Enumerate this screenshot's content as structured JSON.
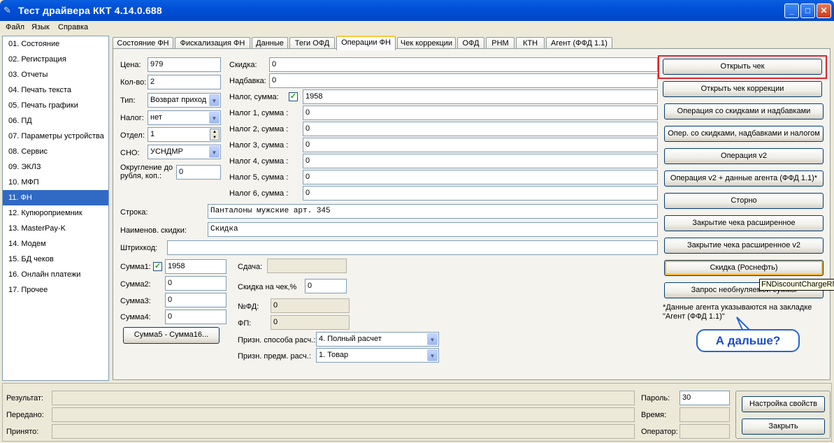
{
  "window": {
    "title": "Тест драйвера ККТ 4.14.0.688",
    "controls": {
      "minimize": "_",
      "maximize": "□",
      "close": "✕"
    },
    "title_color": "#0050d8"
  },
  "menu": [
    "Файл",
    "Язык",
    "Справка"
  ],
  "nav": {
    "items": [
      "01. Состояние",
      "02. Регистрация",
      "03. Отчеты",
      "04. Печать текста",
      "05. Печать графики",
      "06. ПД",
      "07. Параметры устройства",
      "08. Сервис",
      "09. ЭКЛЗ",
      "10. МФП",
      "11. ФН",
      "12. Купюроприемник",
      "13. MasterPay-K",
      "14. Модем",
      "15. БД чеков",
      "16. Онлайн платежи",
      "17. Прочее"
    ],
    "selected": "11. ФН",
    "selected_color": "#316ac5"
  },
  "tabs": [
    "Состояние ФН",
    "Фискализация ФН",
    "Данные",
    "Теги ОФД",
    "Операции ФН",
    "Чек коррекции",
    "ОФД",
    "РНМ",
    "КТН",
    "Агент (ФФД 1.1)"
  ],
  "active_tab": "Операции ФН",
  "form": {
    "price": {
      "label": "Цена:",
      "value": "979"
    },
    "qty": {
      "label": "Кол-во:",
      "value": "2"
    },
    "type": {
      "label": "Тип:",
      "value": "Возврат приход"
    },
    "tax": {
      "label": "Налог:",
      "value": "нет"
    },
    "dept": {
      "label": "Отдел:",
      "value": "1"
    },
    "sno": {
      "label": "СНО:",
      "value": "УСНДМР"
    },
    "rounding": {
      "label": "Округление до рубля, коп.:",
      "value": "0"
    },
    "discount": {
      "label": "Скидка:",
      "value": "0"
    },
    "markup": {
      "label": "Надбавка:",
      "value": "0"
    },
    "tax_sum": {
      "label": "Налог, сумма:",
      "value": "1958",
      "checked": true
    },
    "tax_sums": [
      {
        "label": "Налог 1, сумма :",
        "value": "0"
      },
      {
        "label": "Налог 2, сумма :",
        "value": "0"
      },
      {
        "label": "Налог 3, сумма :",
        "value": "0"
      },
      {
        "label": "Налог 4, сумма :",
        "value": "0"
      },
      {
        "label": "Налог 5, сумма :",
        "value": "0"
      },
      {
        "label": "Налог 6, сумма :",
        "value": "0"
      }
    ],
    "line": {
      "label": "Строка:",
      "value": "Панталоны мужские арт. 345"
    },
    "discount_name": {
      "label": "Наименов. скидки:",
      "value": "Скидка"
    },
    "barcode": {
      "label": "Штрихкод:",
      "value": ""
    },
    "sum1": {
      "label": "Сумма1:",
      "value": "1958",
      "checked": true
    },
    "sum2": {
      "label": "Сумма2:",
      "value": "0"
    },
    "sum3": {
      "label": "Сумма3:",
      "value": "0"
    },
    "sum4": {
      "label": "Сумма4:",
      "value": "0"
    },
    "sum5_16_button": "Сумма5 - Сумма16...",
    "change": {
      "label": "Сдача:",
      "value": ""
    },
    "check_discount": {
      "label": "Скидка на чек,%",
      "value": "0"
    },
    "fd_number": {
      "label": "№ФД:",
      "value": "0"
    },
    "fp": {
      "label": "ФП:",
      "value": "0"
    },
    "payment_method": {
      "label": "Призн. способа расч.:",
      "value": "4. Полный расчет"
    },
    "payment_subject": {
      "label": "Призн. предм. расч.:",
      "value": "1. Товар"
    }
  },
  "actions": [
    "Открыть чек",
    "Открыть чек коррекции",
    "Операция со скидками и надбавками",
    "Опер. со скидками, надбавками и налогом",
    "Операция v2",
    "Операция v2 + данные агента (ФФД 1.1)*",
    "Сторно",
    "Закрытие чека расширенное",
    "Закрытие чека расширенное v2",
    "Скидка (Роснефть)",
    "Запрос необнуляемой суммы"
  ],
  "highlight_color": "#e0242a",
  "agent_note": "*Данные агента указываются на закладке \"Агент (ФФД 1.1)\"",
  "tooltip": "FNDiscountChargeRN",
  "callout": "А дальше?",
  "callout_color": "#1a4dcc",
  "bottom": {
    "result": {
      "label": "Результат:",
      "value": ""
    },
    "sent": {
      "label": "Передано:",
      "value": ""
    },
    "received": {
      "label": "Принято:",
      "value": ""
    },
    "password": {
      "label": "Пароль:",
      "value": "30"
    },
    "time": {
      "label": "Время:",
      "value": ""
    },
    "operator": {
      "label": "Оператор:",
      "value": ""
    },
    "settings_button": "Настройка свойств",
    "close_button": "Закрыть"
  }
}
